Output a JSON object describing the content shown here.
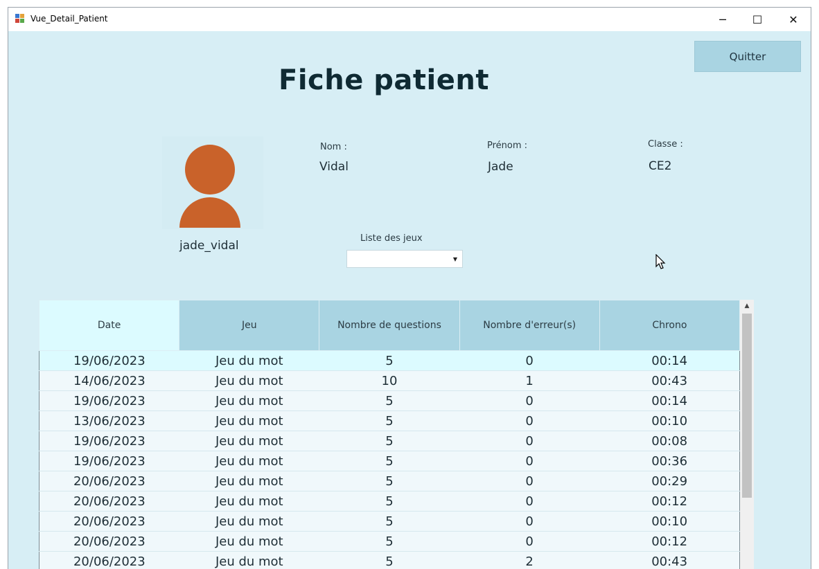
{
  "window": {
    "title": "Vue_Detail_Patient",
    "icon": "app-form-icon",
    "controls": {
      "minimize": "─",
      "maximize": "☐",
      "close": "✕"
    }
  },
  "header": {
    "title": "Fiche patient",
    "quit_label": "Quitter"
  },
  "patient": {
    "avatar": "user-avatar-icon",
    "username": "jade_vidal",
    "nom_label": "Nom :",
    "nom_value": "Vidal",
    "prenom_label": "Prénom :",
    "prenom_value": "Jade",
    "classe_label": "Classe :",
    "classe_value": "CE2"
  },
  "games": {
    "label": "Liste des jeux",
    "selected": ""
  },
  "table": {
    "columns": [
      "Date",
      "Jeu",
      "Nombre de questions",
      "Nombre d'erreur(s)",
      "Chrono"
    ],
    "rows": [
      [
        "19/06/2023",
        "Jeu du mot",
        "5",
        "0",
        "00:14"
      ],
      [
        "14/06/2023",
        "Jeu du mot",
        "10",
        "1",
        "00:43"
      ],
      [
        "19/06/2023",
        "Jeu du mot",
        "5",
        "0",
        "00:14"
      ],
      [
        "13/06/2023",
        "Jeu du mot",
        "5",
        "0",
        "00:10"
      ],
      [
        "19/06/2023",
        "Jeu du mot",
        "5",
        "0",
        "00:08"
      ],
      [
        "19/06/2023",
        "Jeu du mot",
        "5",
        "0",
        "00:36"
      ],
      [
        "20/06/2023",
        "Jeu du mot",
        "5",
        "0",
        "00:29"
      ],
      [
        "20/06/2023",
        "Jeu du mot",
        "5",
        "0",
        "00:12"
      ],
      [
        "20/06/2023",
        "Jeu du mot",
        "5",
        "0",
        "00:10"
      ],
      [
        "20/06/2023",
        "Jeu du mot",
        "5",
        "0",
        "00:12"
      ],
      [
        "20/06/2023",
        "Jeu du mot",
        "5",
        "2",
        "00:43"
      ]
    ]
  },
  "colors": {
    "background": "#d7eef5",
    "header_cell": "#a9d4e2",
    "selected_row": "#dcfbff",
    "avatar": "#c9622a"
  }
}
